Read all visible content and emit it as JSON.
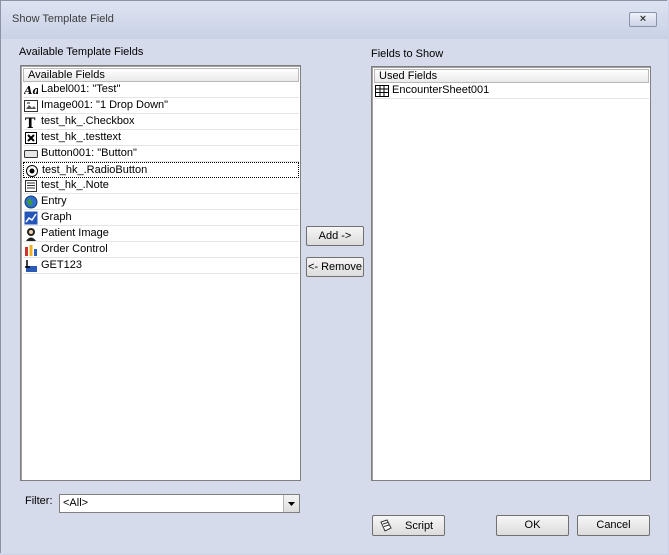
{
  "window": {
    "title": "Show Template Field",
    "close_glyph": "×"
  },
  "available": {
    "group_label": "Available Template Fields",
    "column_header": "Available Fields",
    "items": [
      {
        "label": "Label001: \"Test\"",
        "icon": "label-text-icon"
      },
      {
        "label": "Image001: \"1 Drop Down\"",
        "icon": "image-dropdown-icon"
      },
      {
        "label": "test_hk_.Checkbox",
        "icon": "text-field-icon"
      },
      {
        "label": "test_hk_.testtext",
        "icon": "checkbox-x-icon"
      },
      {
        "label": "Button001: \"Button\"",
        "icon": "button-icon"
      },
      {
        "label": "test_hk_.RadioButton",
        "icon": "radio-button-icon"
      },
      {
        "label": "test_hk_.Note",
        "icon": "note-icon"
      },
      {
        "label": "Entry",
        "icon": "globe-icon"
      },
      {
        "label": "Graph",
        "icon": "graph-icon"
      },
      {
        "label": "Patient Image",
        "icon": "patient-image-icon"
      },
      {
        "label": "Order Control",
        "icon": "order-control-icon"
      },
      {
        "label": "GET123",
        "icon": "get-field-icon"
      }
    ]
  },
  "to_show": {
    "group_label": "Fields to Show",
    "column_header": "Used Fields",
    "items": [
      {
        "label": "EncounterSheet001",
        "icon": "table-grid-icon"
      }
    ]
  },
  "buttons": {
    "add": "Add ->",
    "remove": "<- Remove",
    "script": "Script",
    "ok": "OK",
    "cancel": "Cancel"
  },
  "filter": {
    "label": "Filter:",
    "value": "<All>"
  }
}
